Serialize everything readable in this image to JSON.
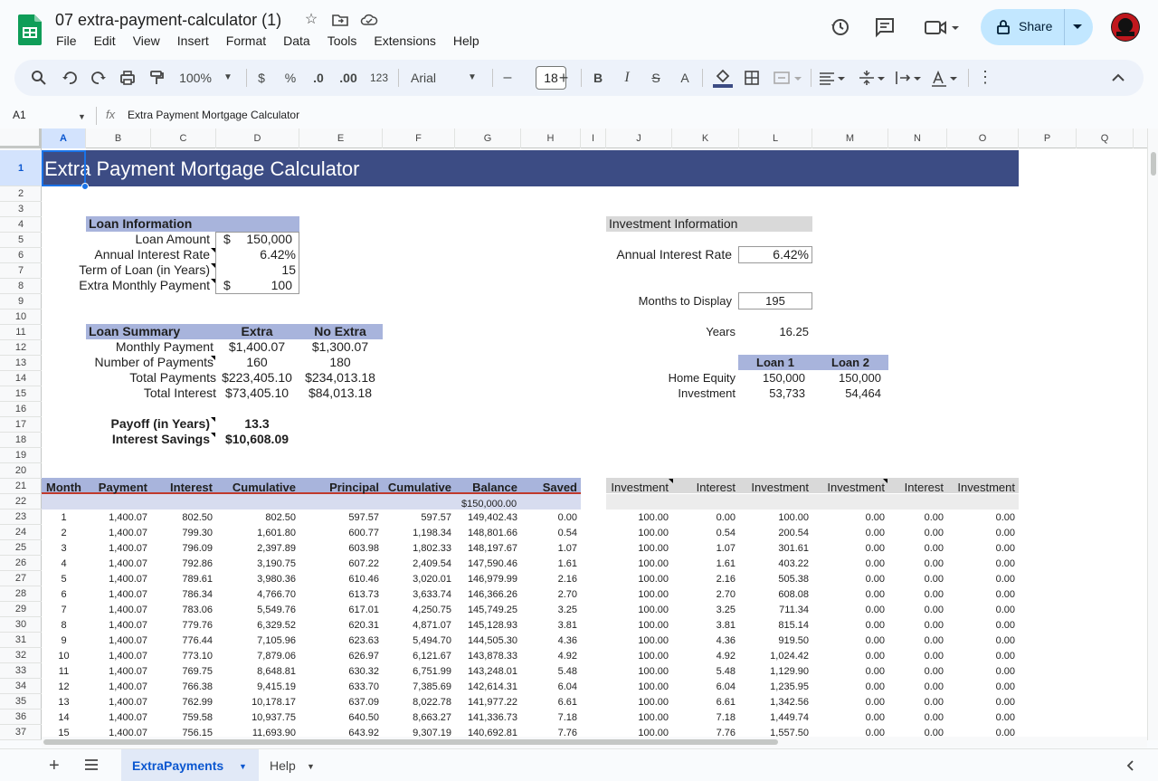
{
  "document": {
    "title": "07 extra-payment-calculator (1)"
  },
  "menu": [
    "File",
    "Edit",
    "View",
    "Insert",
    "Format",
    "Data",
    "Tools",
    "Extensions",
    "Help"
  ],
  "share": {
    "label": "Share"
  },
  "toolbar": {
    "zoom": "100%",
    "currency": "$",
    "percent": "%",
    "decrease_decimal": ".0",
    "increase_decimal": ".00",
    "number_format": "123",
    "font": "Arial",
    "font_size": "18",
    "minus": "–",
    "plus": "+",
    "bold": "B",
    "italic": "I",
    "strike": "S",
    "text_color": "A"
  },
  "formula_bar": {
    "cell_ref": "A1",
    "fx": "fx",
    "content": "Extra Payment Mortgage Calculator"
  },
  "columns": [
    "A",
    "B",
    "C",
    "D",
    "E",
    "F",
    "G",
    "H",
    "I",
    "J",
    "K",
    "L",
    "M",
    "N",
    "O",
    "P",
    "Q"
  ],
  "rows": [
    "1",
    "2",
    "3",
    "4",
    "5",
    "6",
    "7",
    "8",
    "9",
    "10",
    "11",
    "12",
    "13",
    "14",
    "15",
    "16",
    "17",
    "18",
    "19",
    "20",
    "21",
    "22",
    "23",
    "24",
    "25",
    "26",
    "27",
    "28",
    "29",
    "30",
    "31",
    "32",
    "33",
    "34",
    "35",
    "36",
    "37"
  ],
  "sheet_title": "Extra Payment Mortgage Calculator",
  "loan_info": {
    "header": "Loan Information",
    "labels": [
      "Loan Amount",
      "Annual Interest Rate",
      "Term of Loan (in Years)",
      "Extra Monthly Payment"
    ],
    "amount_symbol": "$",
    "amount_value": "150,000",
    "rate": "6.42%",
    "term": "15",
    "extra_symbol": "$",
    "extra_value": "100"
  },
  "loan_summary": {
    "header": "Loan Summary",
    "col_extra": "Extra",
    "col_noextra": "No Extra",
    "rows": [
      {
        "label": "Monthly Payment",
        "extra": "$1,400.07",
        "noextra": "$1,300.07"
      },
      {
        "label": "Number of Payments",
        "extra": "160",
        "noextra": "180"
      },
      {
        "label": "Total Payments",
        "extra": "$223,405.10",
        "noextra": "$234,013.18"
      },
      {
        "label": "Total Interest",
        "extra": "$73,405.10",
        "noextra": "$84,013.18"
      }
    ],
    "payoff_label": "Payoff (in Years)",
    "payoff_value": "13.3",
    "savings_label": "Interest Savings",
    "savings_value": "$10,608.09"
  },
  "investment": {
    "header": "Investment Information",
    "rate_label": "Annual Interest Rate",
    "rate_value": "6.42%",
    "months_label": "Months to Display",
    "months_value": "195",
    "years_label": "Years",
    "years_value": "16.25",
    "loan1": "Loan 1",
    "loan2": "Loan 2",
    "equity_label": "Home Equity",
    "equity_1": "150,000",
    "equity_2": "150,000",
    "invest_label": "Investment",
    "invest_1": "53,733",
    "invest_2": "54,464"
  },
  "schedule": {
    "headers": [
      "Month",
      "Payment",
      "Interest",
      "Cumulative",
      "Principal",
      "Cumulative",
      "Balance",
      "Saved"
    ],
    "inv_headers": [
      "Investment",
      "Interest",
      "Investment",
      "Investment",
      "Interest",
      "Investment"
    ],
    "start_balance": "$150,000.00",
    "rows": [
      [
        "1",
        "1,400.07",
        "802.50",
        "802.50",
        "597.57",
        "597.57",
        "149,402.43",
        "0.00",
        "100.00",
        "0.00",
        "100.00",
        "0.00",
        "0.00",
        "0.00"
      ],
      [
        "2",
        "1,400.07",
        "799.30",
        "1,601.80",
        "600.77",
        "1,198.34",
        "148,801.66",
        "0.54",
        "100.00",
        "0.54",
        "200.54",
        "0.00",
        "0.00",
        "0.00"
      ],
      [
        "3",
        "1,400.07",
        "796.09",
        "2,397.89",
        "603.98",
        "1,802.33",
        "148,197.67",
        "1.07",
        "100.00",
        "1.07",
        "301.61",
        "0.00",
        "0.00",
        "0.00"
      ],
      [
        "4",
        "1,400.07",
        "792.86",
        "3,190.75",
        "607.22",
        "2,409.54",
        "147,590.46",
        "1.61",
        "100.00",
        "1.61",
        "403.22",
        "0.00",
        "0.00",
        "0.00"
      ],
      [
        "5",
        "1,400.07",
        "789.61",
        "3,980.36",
        "610.46",
        "3,020.01",
        "146,979.99",
        "2.16",
        "100.00",
        "2.16",
        "505.38",
        "0.00",
        "0.00",
        "0.00"
      ],
      [
        "6",
        "1,400.07",
        "786.34",
        "4,766.70",
        "613.73",
        "3,633.74",
        "146,366.26",
        "2.70",
        "100.00",
        "2.70",
        "608.08",
        "0.00",
        "0.00",
        "0.00"
      ],
      [
        "7",
        "1,400.07",
        "783.06",
        "5,549.76",
        "617.01",
        "4,250.75",
        "145,749.25",
        "3.25",
        "100.00",
        "3.25",
        "711.34",
        "0.00",
        "0.00",
        "0.00"
      ],
      [
        "8",
        "1,400.07",
        "779.76",
        "6,329.52",
        "620.31",
        "4,871.07",
        "145,128.93",
        "3.81",
        "100.00",
        "3.81",
        "815.14",
        "0.00",
        "0.00",
        "0.00"
      ],
      [
        "9",
        "1,400.07",
        "776.44",
        "7,105.96",
        "623.63",
        "5,494.70",
        "144,505.30",
        "4.36",
        "100.00",
        "4.36",
        "919.50",
        "0.00",
        "0.00",
        "0.00"
      ],
      [
        "10",
        "1,400.07",
        "773.10",
        "7,879.06",
        "626.97",
        "6,121.67",
        "143,878.33",
        "4.92",
        "100.00",
        "4.92",
        "1,024.42",
        "0.00",
        "0.00",
        "0.00"
      ],
      [
        "11",
        "1,400.07",
        "769.75",
        "8,648.81",
        "630.32",
        "6,751.99",
        "143,248.01",
        "5.48",
        "100.00",
        "5.48",
        "1,129.90",
        "0.00",
        "0.00",
        "0.00"
      ],
      [
        "12",
        "1,400.07",
        "766.38",
        "9,415.19",
        "633.70",
        "7,385.69",
        "142,614.31",
        "6.04",
        "100.00",
        "6.04",
        "1,235.95",
        "0.00",
        "0.00",
        "0.00"
      ],
      [
        "13",
        "1,400.07",
        "762.99",
        "10,178.17",
        "637.09",
        "8,022.78",
        "141,977.22",
        "6.61",
        "100.00",
        "6.61",
        "1,342.56",
        "0.00",
        "0.00",
        "0.00"
      ],
      [
        "14",
        "1,400.07",
        "759.58",
        "10,937.75",
        "640.50",
        "8,663.27",
        "141,336.73",
        "7.18",
        "100.00",
        "7.18",
        "1,449.74",
        "0.00",
        "0.00",
        "0.00"
      ],
      [
        "15",
        "1,400.07",
        "756.15",
        "11,693.90",
        "643.92",
        "9,307.19",
        "140,692.81",
        "7.76",
        "100.00",
        "7.76",
        "1,557.50",
        "0.00",
        "0.00",
        "0.00"
      ]
    ]
  },
  "tabs": {
    "active": "ExtraPayments",
    "other": "Help"
  }
}
